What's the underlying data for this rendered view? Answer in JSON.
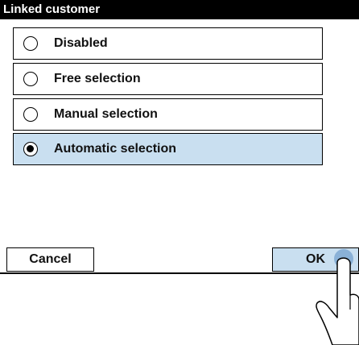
{
  "dialog": {
    "title": "Linked customer"
  },
  "options": [
    {
      "label": "Disabled",
      "selected": false
    },
    {
      "label": "Free selection",
      "selected": false
    },
    {
      "label": "Manual selection",
      "selected": false
    },
    {
      "label": "Automatic selection",
      "selected": true
    }
  ],
  "buttons": {
    "cancel_label": "Cancel",
    "ok_label": "OK"
  },
  "colors": {
    "selected_fill": "#c9dff0",
    "title_bar": "#000000",
    "touch_highlight": "#7fa9d2"
  },
  "icons": {
    "pointer": "pointing-hand-icon"
  }
}
